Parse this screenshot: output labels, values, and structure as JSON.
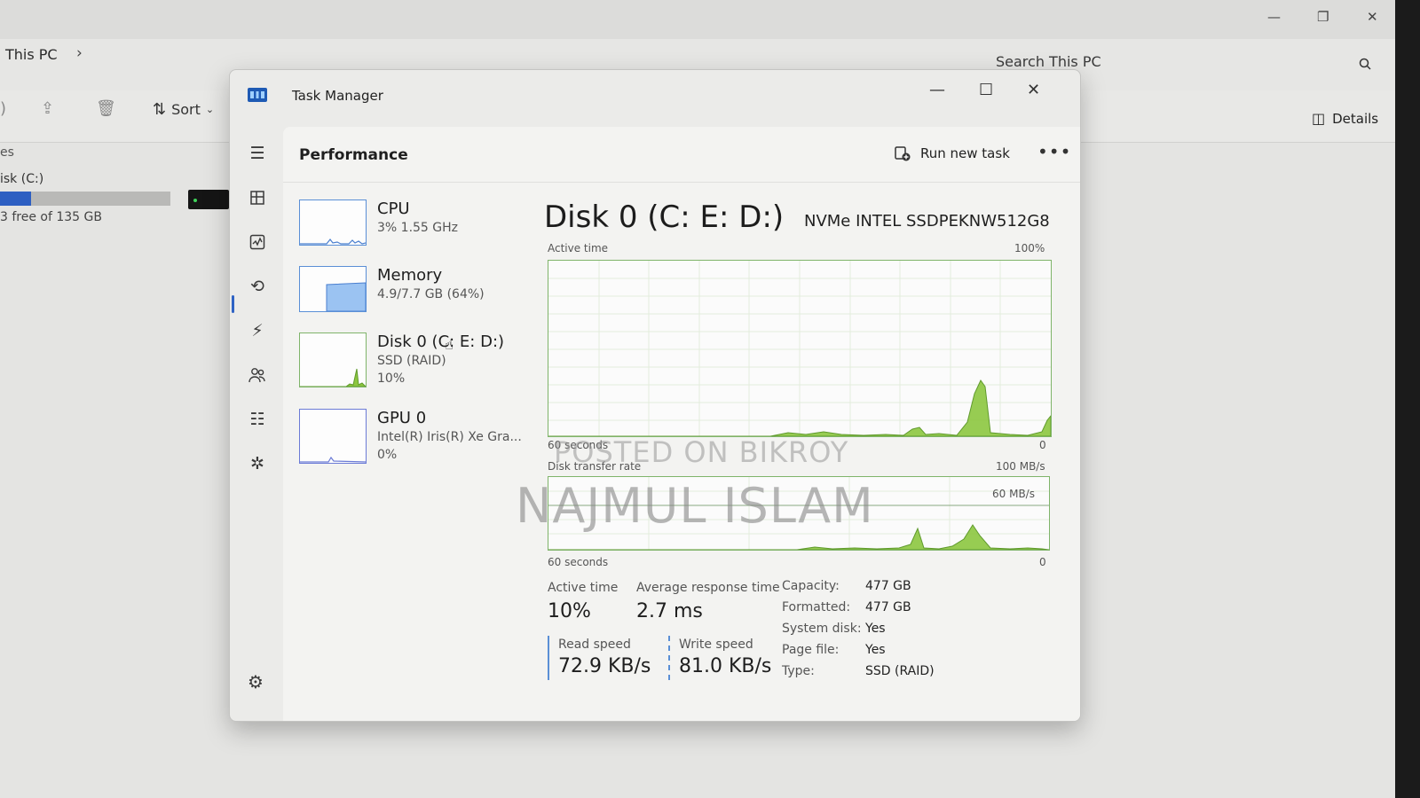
{
  "explorer": {
    "breadcrumb": "This PC",
    "breadcrumb_chevron": "›",
    "search_placeholder": "Search This PC",
    "sort_label": "Sort",
    "details_label": "Details",
    "sidebar_partial": "es",
    "drive_label": "isk (C:)",
    "drive_free": "3 free of 135 GB",
    "drive_used_fraction": 0.18,
    "window_controls": {
      "minimize": "—",
      "maximize": "❐",
      "close": "✕"
    }
  },
  "task_manager": {
    "title": "Task Manager",
    "window_controls": {
      "minimize": "—",
      "maximize": "☐",
      "close": "✕"
    },
    "page_title": "Performance",
    "run_new_task": "Run new task",
    "more": "•••",
    "nav_icons": [
      "hamburger-icon",
      "processes-icon",
      "performance-icon",
      "app-history-icon",
      "startup-apps-icon",
      "users-icon",
      "details-icon",
      "services-icon",
      "settings-icon"
    ],
    "resources": [
      {
        "name": "CPU",
        "line1": "3% 1.55 GHz",
        "line2": ""
      },
      {
        "name": "Memory",
        "line1": "4.9/7.7 GB (64%)",
        "line2": ""
      },
      {
        "name": "Disk 0 (C: E: D:)",
        "line1": "SSD (RAID)",
        "line2": "10%"
      },
      {
        "name": "GPU 0",
        "line1": "Intel(R) Iris(R) Xe Gra...",
        "line2": "0%"
      }
    ],
    "disk": {
      "title": "Disk 0 (C: E: D:)",
      "model": "NVMe INTEL SSDPEKNW512G8",
      "active_time_graph": {
        "label": "Active time",
        "max": "100%",
        "x_label": "60 seconds",
        "min": "0"
      },
      "transfer_graph": {
        "label": "Disk transfer rate",
        "max": "100 MB/s",
        "mid": "60 MB/s",
        "x_label": "60 seconds",
        "min": "0"
      },
      "stats": {
        "active_time_label": "Active time",
        "active_time": "10%",
        "avg_response_label": "Average response time",
        "avg_response": "2.7 ms",
        "read_label": "Read speed",
        "read": "72.9 KB/s",
        "write_label": "Write speed",
        "write": "81.0 KB/s"
      },
      "properties": [
        {
          "key": "Capacity:",
          "value": "477 GB"
        },
        {
          "key": "Formatted:",
          "value": "477 GB"
        },
        {
          "key": "System disk:",
          "value": "Yes"
        },
        {
          "key": "Page file:",
          "value": "Yes"
        },
        {
          "key": "Type:",
          "value": "SSD (RAID)"
        }
      ]
    }
  },
  "watermark": {
    "line1": "POSTED ON BIKROY",
    "line2": "NAJMUL ISLAM"
  },
  "colors": {
    "graph_green": "#8cc63f",
    "accent_blue": "#2f63c4",
    "memory_blue": "#9bc3f2"
  }
}
